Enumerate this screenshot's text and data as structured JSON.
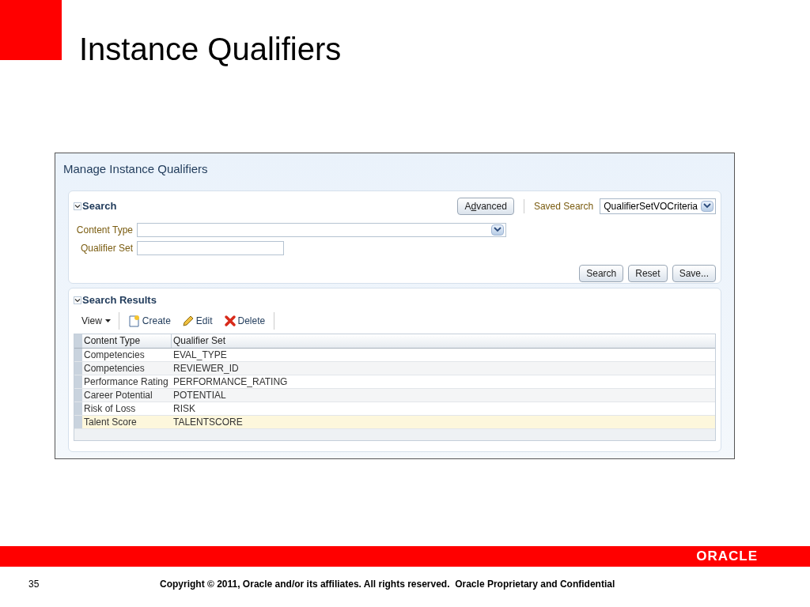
{
  "slide": {
    "title": "Instance Qualifiers",
    "page_number": "35",
    "footer": "Copyright © 2011, Oracle and/or its affiliates. All rights reserved.  Oracle Proprietary and Confidential",
    "logo": "ORACLE"
  },
  "app": {
    "page_title": "Manage Instance Qualifiers",
    "search": {
      "title": "Search",
      "expanded": true,
      "advanced": {
        "label_before": "A",
        "mnemonic": "d",
        "label_after": "vanced"
      },
      "saved_search_label": "Saved Search",
      "saved_search_value": "QualifierSetVOCriteria",
      "fields": [
        {
          "kind": "select",
          "label": "Content Type"
        },
        {
          "kind": "text",
          "label": "Qualifier Set"
        }
      ],
      "buttons": [
        "Search",
        "Reset",
        "Save..."
      ]
    },
    "results": {
      "title": "Search Results",
      "expanded": true,
      "view_menu": "View",
      "toolbar": [
        {
          "kind": "create",
          "label": "Create"
        },
        {
          "kind": "edit",
          "label": "Edit"
        },
        {
          "kind": "delete",
          "label": "Delete"
        }
      ],
      "columns": [
        "Content Type",
        "Qualifier Set"
      ],
      "rows": [
        {
          "cells": [
            "Competencies",
            "EVAL_TYPE"
          ],
          "selected": false
        },
        {
          "cells": [
            "Competencies",
            "REVIEWER_ID"
          ],
          "selected": false
        },
        {
          "cells": [
            "Performance Rating",
            "PERFORMANCE_RATING"
          ],
          "selected": false
        },
        {
          "cells": [
            "Career Potential",
            "POTENTIAL"
          ],
          "selected": false
        },
        {
          "cells": [
            "Risk of Loss",
            "RISK"
          ],
          "selected": false
        },
        {
          "cells": [
            "Talent Score",
            "TALENTSCORE"
          ],
          "selected": true
        }
      ]
    }
  }
}
